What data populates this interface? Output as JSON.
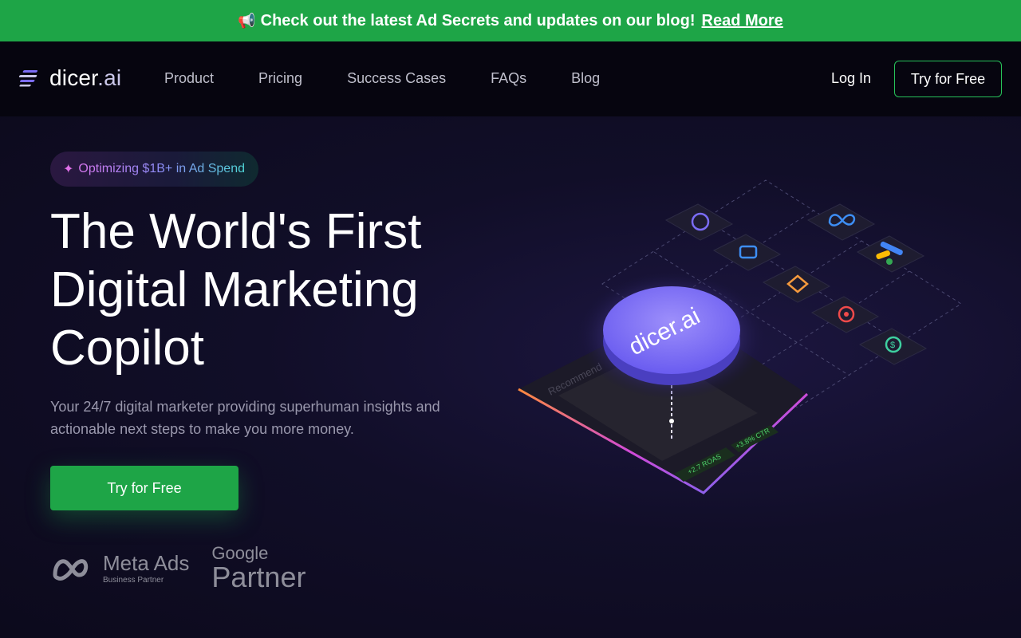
{
  "announcement": {
    "text": "Check out the latest Ad Secrets and updates on our blog!",
    "link": "Read More"
  },
  "nav": {
    "logo_text": "dicer",
    "logo_suffix": ".ai",
    "links": [
      "Product",
      "Pricing",
      "Success Cases",
      "FAQs",
      "Blog"
    ],
    "login": "Log In",
    "try_button": "Try for Free"
  },
  "hero": {
    "badge": "Optimizing $1B+ in Ad Spend",
    "headline": [
      "The World's First",
      "Digital Marketing",
      "Copilot"
    ],
    "subtext": "Your 24/7 digital marketer providing superhuman insights and actionable next steps to make you more money.",
    "cta": "Try for Free",
    "partners": {
      "meta_name": "Meta Ads",
      "meta_sub": "Business Partner",
      "google_name": "Google",
      "google_sub": "Partner"
    }
  },
  "illustration": {
    "disc_label": "dicer.ai",
    "card_title": "Recommend",
    "stat1": "+2.7 ROAS",
    "stat2": "+3.8% CTR"
  },
  "colors": {
    "accent_green": "#1ea547",
    "bg_dark": "#0c0a1c",
    "disc_purple": "#7b6cf5"
  }
}
